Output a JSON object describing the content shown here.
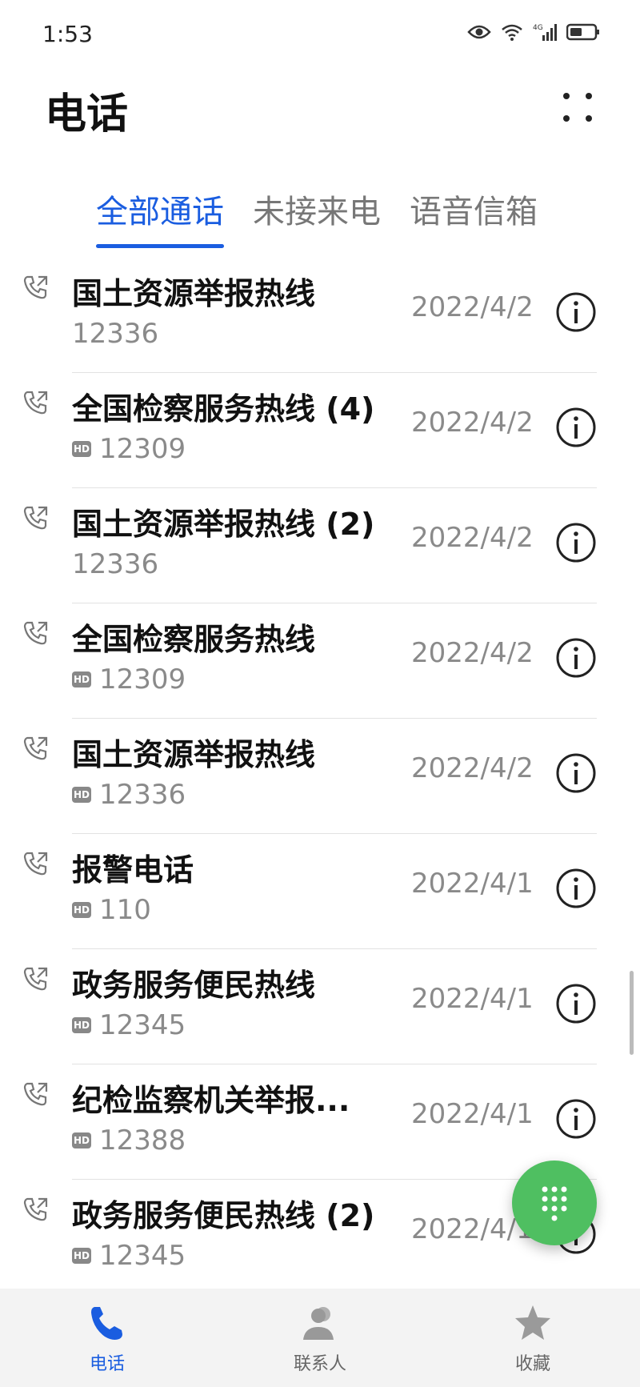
{
  "status_bar": {
    "time": "1:53",
    "network": "4G"
  },
  "header": {
    "title": "电话"
  },
  "tabs": [
    {
      "label": "全部通话",
      "active": true
    },
    {
      "label": "未接来电",
      "active": false
    },
    {
      "label": "语音信箱",
      "active": false
    }
  ],
  "calls": [
    {
      "name": "国土资源举报热线",
      "number": "12336",
      "hd": false,
      "date": "2022/4/2"
    },
    {
      "name": "全国检察服务热线 (4)",
      "number": "12309",
      "hd": true,
      "date": "2022/4/2"
    },
    {
      "name": "国土资源举报热线 (2)",
      "number": "12336",
      "hd": false,
      "date": "2022/4/2"
    },
    {
      "name": "全国检察服务热线",
      "number": "12309",
      "hd": true,
      "date": "2022/4/2"
    },
    {
      "name": "国土资源举报热线",
      "number": "12336",
      "hd": true,
      "date": "2022/4/2"
    },
    {
      "name": "报警电话",
      "number": "110",
      "hd": true,
      "date": "2022/4/1"
    },
    {
      "name": "政务服务便民热线",
      "number": "12345",
      "hd": true,
      "date": "2022/4/1"
    },
    {
      "name": "纪检监察机关举报...",
      "number": "12388",
      "hd": true,
      "date": "2022/4/1"
    },
    {
      "name": "政务服务便民热线 (2)",
      "number": "12345",
      "hd": true,
      "date": "2022/4/1"
    }
  ],
  "hd_badge": "HD",
  "bottom_nav": [
    {
      "label": "电话",
      "icon": "phone-icon",
      "active": true
    },
    {
      "label": "联系人",
      "icon": "contacts-icon",
      "active": false
    },
    {
      "label": "收藏",
      "icon": "star-icon",
      "active": false
    }
  ],
  "colors": {
    "accent": "#1a5de0",
    "fab": "#4fbf61",
    "secondary_text": "#8a8a8a"
  }
}
